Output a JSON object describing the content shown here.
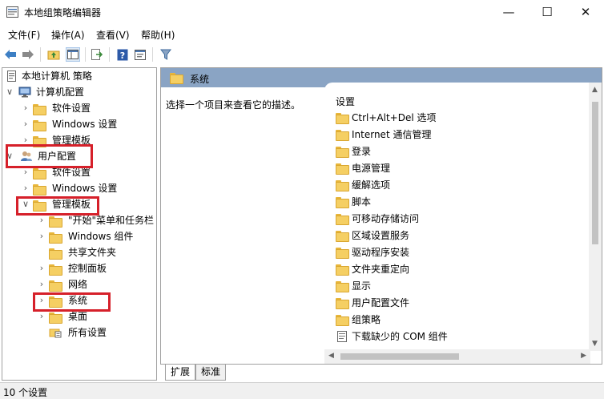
{
  "window": {
    "title": "本地组策略编辑器",
    "minimize_glyph": "—",
    "maximize_glyph": "☐",
    "close_glyph": "✕"
  },
  "menu": [
    "文件(F)",
    "操作(A)",
    "查看(V)",
    "帮助(H)"
  ],
  "toolbar": {
    "icons": [
      "back-arrow-icon",
      "forward-arrow-icon",
      "up-folder-icon",
      "show-hide-tree-icon",
      "export-list-icon",
      "help-icon",
      "properties-icon",
      "filter-icon"
    ]
  },
  "tree": {
    "root": "本地计算机 策略",
    "computer_config": "计算机配置",
    "cc_software": "软件设置",
    "cc_windows": "Windows 设置",
    "cc_admin": "管理模板",
    "user_config": "用户配置",
    "uc_software": "软件设置",
    "uc_windows": "Windows 设置",
    "uc_admin": "管理模板",
    "admin_children": [
      "\"开始\"菜单和任务栏",
      "Windows 组件",
      "共享文件夹",
      "控制面板",
      "网络",
      "系统",
      "桌面",
      "所有设置"
    ]
  },
  "right": {
    "header_title": "系统",
    "description": "选择一个项目来查看它的描述。",
    "column_header": "设置",
    "items": [
      "Ctrl+Alt+Del 选项",
      "Internet 通信管理",
      "登录",
      "电源管理",
      "缓解选项",
      "脚本",
      "可移动存储访问",
      "区域设置服务",
      "驱动程序安装",
      "文件夹重定向",
      "显示",
      "用户配置文件",
      "组策略",
      "下载缺少的 COM 组件"
    ]
  },
  "tabs": [
    "扩展",
    "标准"
  ],
  "status": "10 个设置",
  "colors": {
    "header_bg": "#8aa4c4",
    "highlight_border": "#d6202a",
    "folder_yellow": "#f5cf63"
  }
}
